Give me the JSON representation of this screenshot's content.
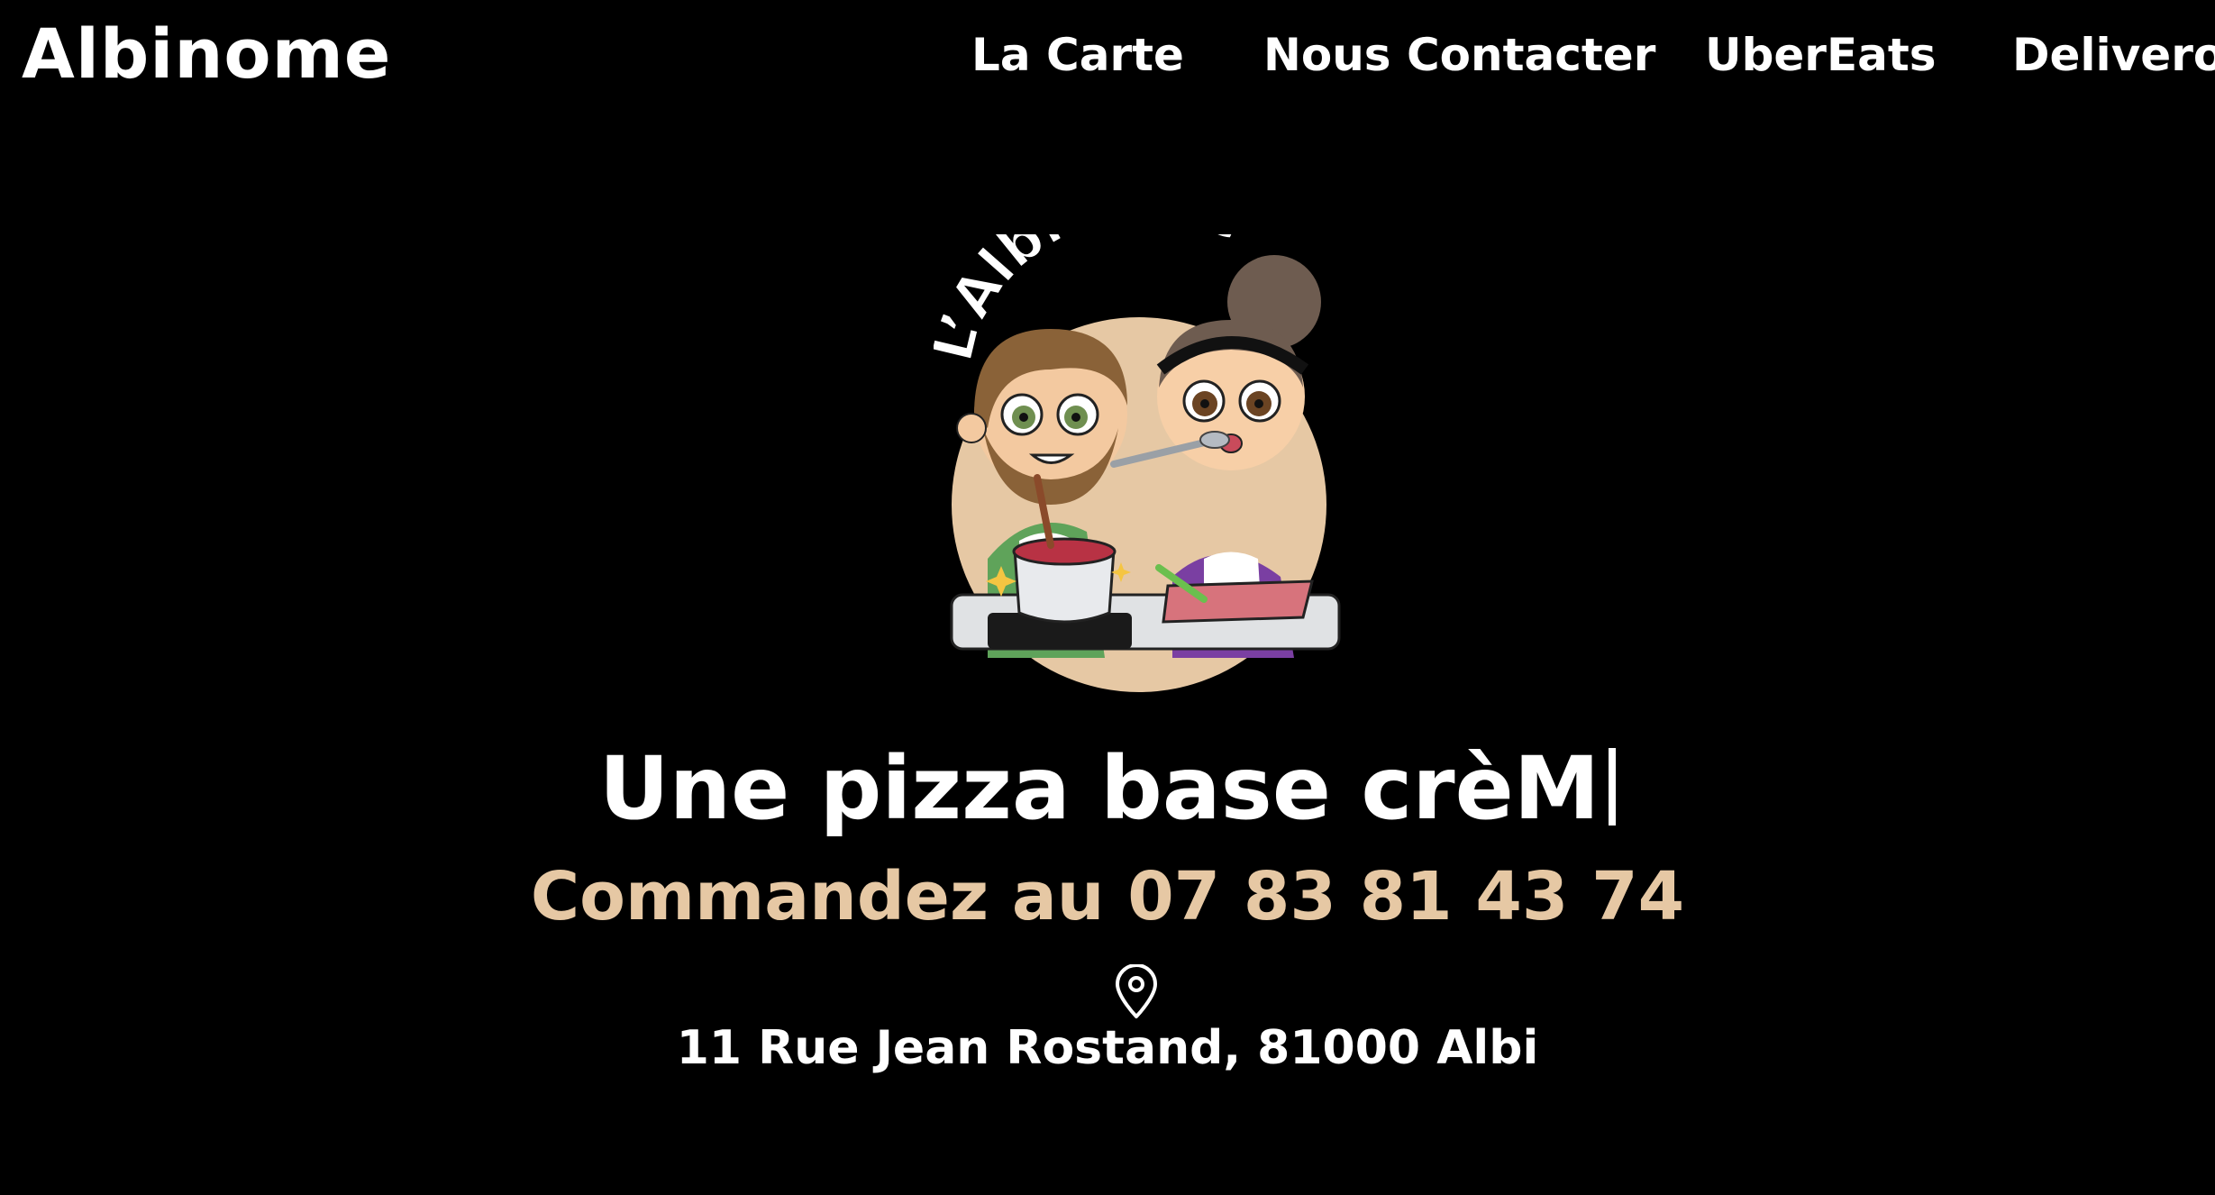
{
  "header": {
    "brand": "Albinome",
    "nav": [
      {
        "label": "La Carte"
      },
      {
        "label": "Nous Contacter"
      },
      {
        "label": "UberEats"
      },
      {
        "label": "Deliveroo"
      }
    ]
  },
  "logo": {
    "title": "L’Albinôme",
    "icon": "chefs-cooking-illustration"
  },
  "hero": {
    "headline": "Une pizza base crèM",
    "order_text": "Commandez au 07 83 81 43 74",
    "address_icon": "map-pin-icon",
    "address": "11 Rue Jean Rostand, 81000 Albi"
  },
  "colors": {
    "background": "#000000",
    "text": "#ffffff",
    "accent": "#e6c8a4"
  }
}
